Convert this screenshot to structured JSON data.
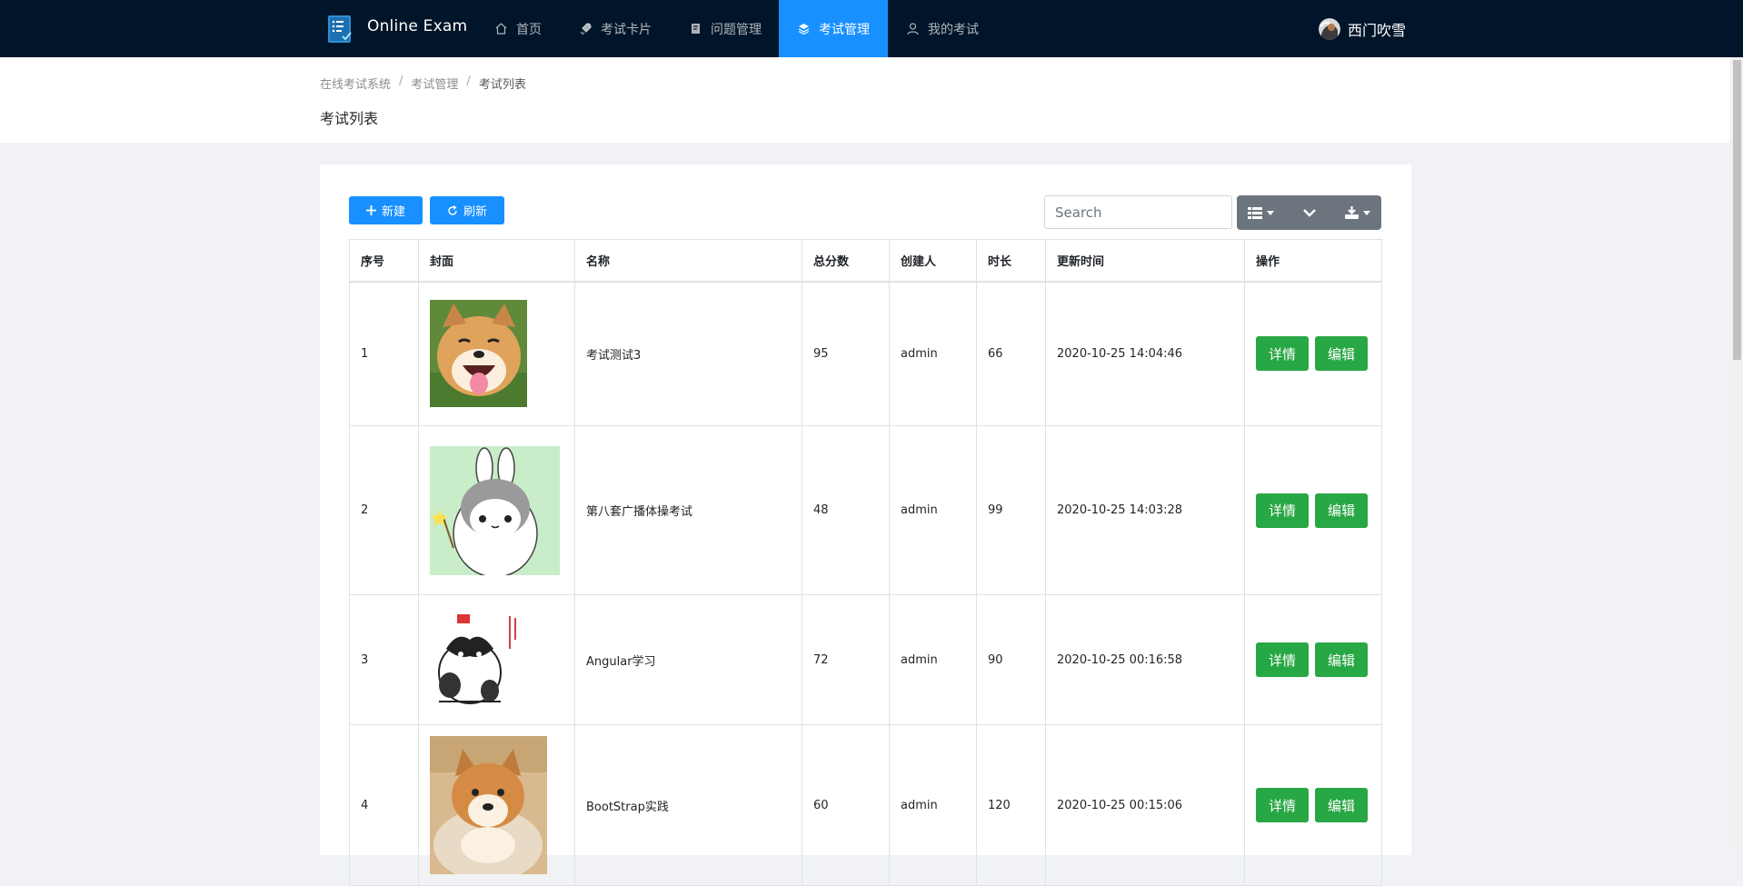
{
  "app": {
    "title": "Online Exam"
  },
  "nav": {
    "items": [
      {
        "label": "首页",
        "icon": "home-icon"
      },
      {
        "label": "考试卡片",
        "icon": "rocket-icon"
      },
      {
        "label": "问题管理",
        "icon": "book-icon"
      },
      {
        "label": "考试管理",
        "icon": "layers-icon",
        "active": true
      },
      {
        "label": "我的考试",
        "icon": "user-icon"
      }
    ]
  },
  "user": {
    "name": "西门吹雪"
  },
  "breadcrumb": {
    "items": [
      "在线考试系统",
      "考试管理",
      "考试列表"
    ],
    "separator": "/"
  },
  "page": {
    "title": "考试列表"
  },
  "toolbar": {
    "new_label": "新建",
    "refresh_label": "刷新",
    "search_placeholder": "Search"
  },
  "table": {
    "headers": [
      "序号",
      "封面",
      "名称",
      "总分数",
      "创建人",
      "时长",
      "更新时间",
      "操作"
    ],
    "rows": [
      {
        "index": "1",
        "cover": "shiba-smiling",
        "name": "考试测试3",
        "score": "95",
        "creator": "admin",
        "duration": "66",
        "updated": "2020-10-25 14:04:46"
      },
      {
        "index": "2",
        "cover": "cartoon-rabbit",
        "name": "第八套广播体操考试",
        "score": "48",
        "creator": "admin",
        "duration": "99",
        "updated": "2020-10-25 14:03:28"
      },
      {
        "index": "3",
        "cover": "cartoon-cat",
        "name": "Angular学习",
        "score": "72",
        "creator": "admin",
        "duration": "90",
        "updated": "2020-10-25 00:16:58"
      },
      {
        "index": "4",
        "cover": "shiba-puppy",
        "name": "BootStrap实践",
        "score": "60",
        "creator": "admin",
        "duration": "120",
        "updated": "2020-10-25 00:15:06"
      }
    ],
    "detail_label": "详情",
    "edit_label": "编辑"
  },
  "colors": {
    "nav_bg": "#001529",
    "nav_active": "#1890ff",
    "primary": "#1890ff",
    "success": "#28a745",
    "secondary": "#6c757d",
    "page_bg": "#f0f2f5"
  }
}
